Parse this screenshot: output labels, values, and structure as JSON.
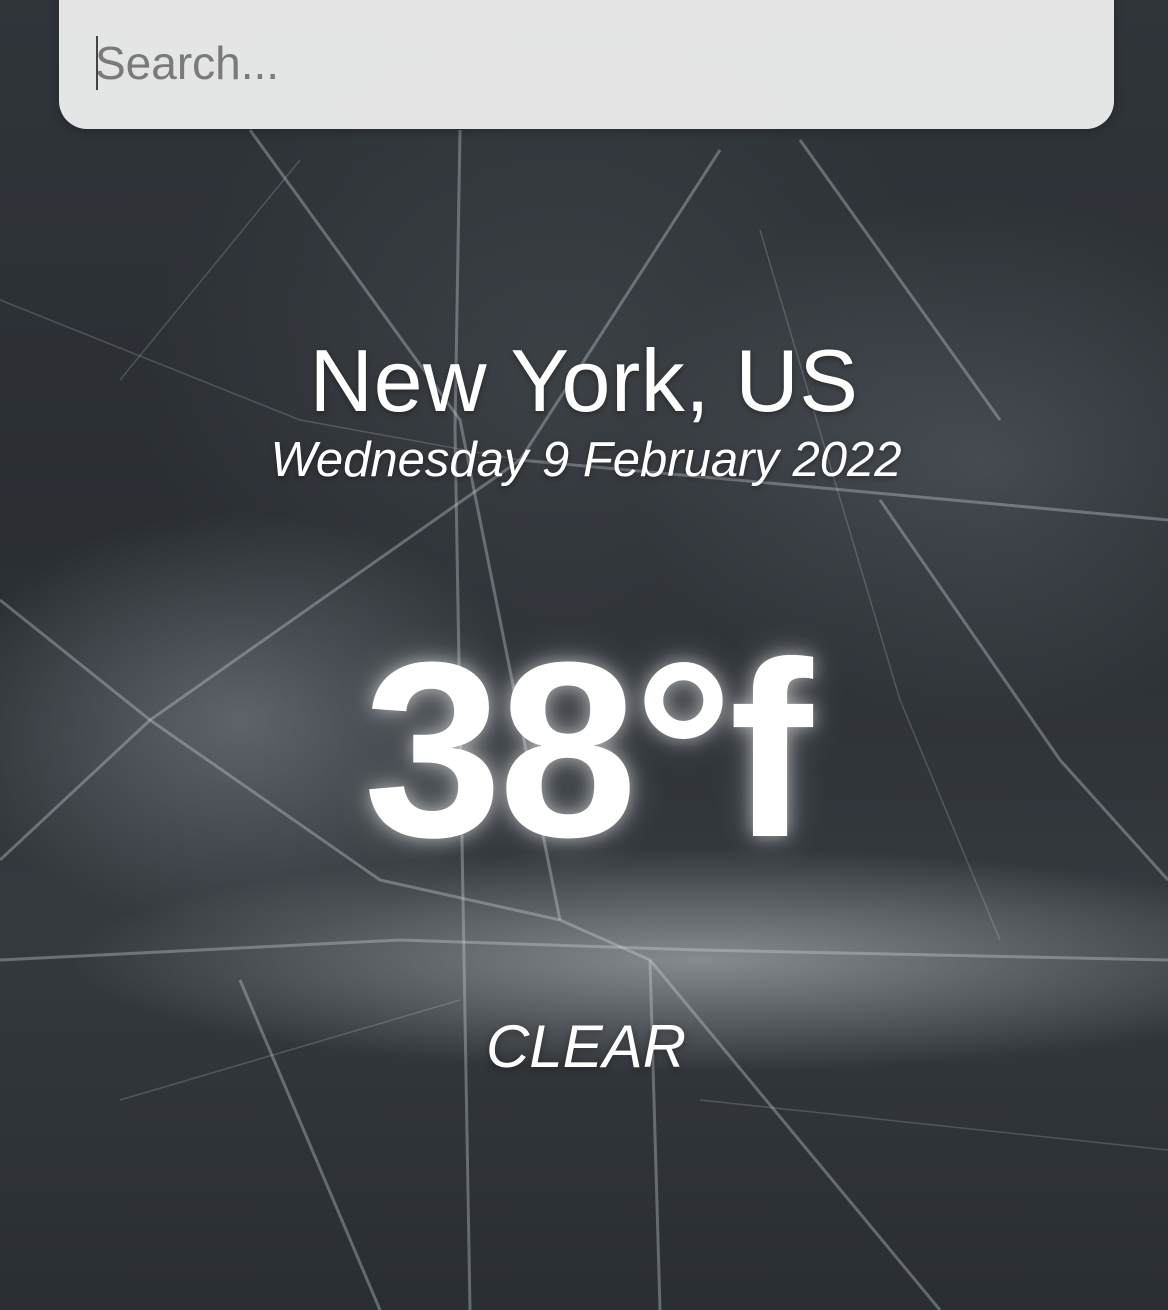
{
  "search": {
    "placeholder": "Search...",
    "value": ""
  },
  "weather": {
    "location": "New York, US",
    "date": "Wednesday 9 February 2022",
    "temperature": "38°f",
    "condition": "CLEAR"
  },
  "colors": {
    "text": "#ffffff",
    "search_background": "#f0f0f0",
    "placeholder": "#7a7a7a"
  }
}
